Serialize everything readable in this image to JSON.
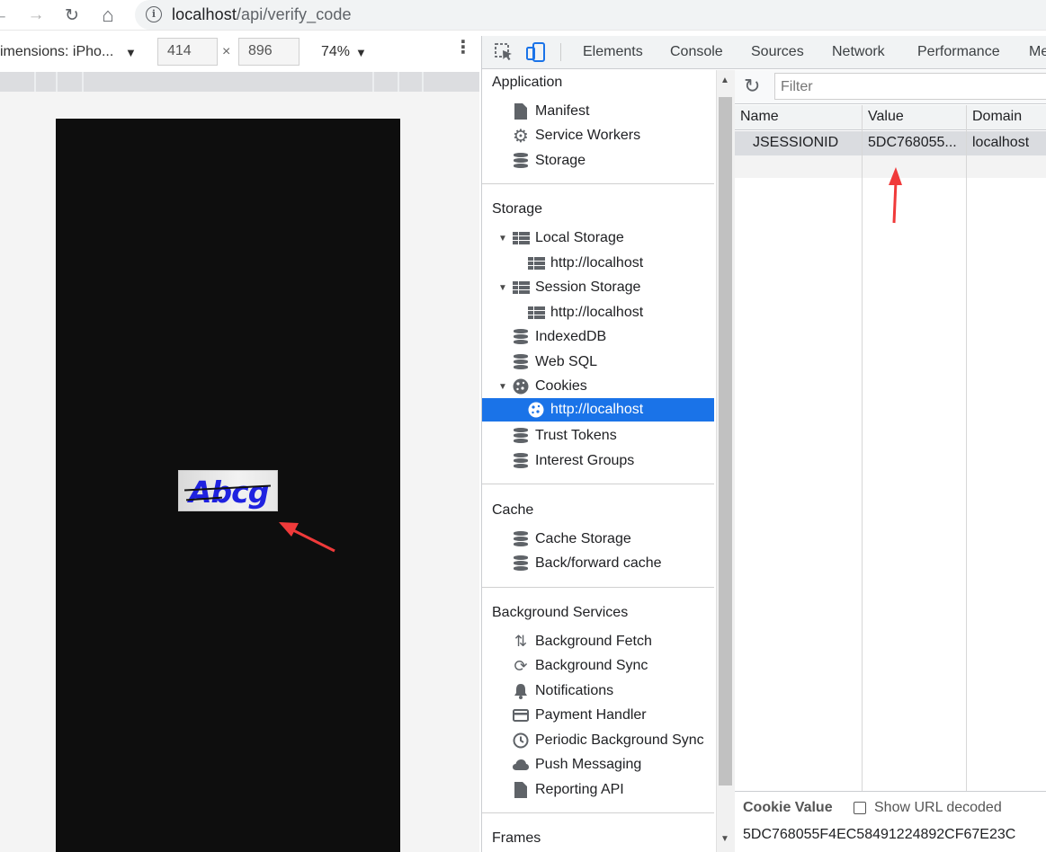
{
  "browser": {
    "url_host": "localhost",
    "url_path": "/api/verify_code",
    "back_glyph": "←",
    "forward_glyph": "→",
    "reload_glyph": "↻",
    "home_glyph": "⌂"
  },
  "device_toolbar": {
    "dimensions_label": "imensions: iPho...",
    "width": "414",
    "height": "896",
    "times": "×",
    "zoom": "74%",
    "caret": "▼",
    "more": "⋮"
  },
  "page": {
    "captcha_text": "Abcg"
  },
  "devtools": {
    "tabs": [
      "Elements",
      "Console",
      "Sources",
      "Network",
      "Performance",
      "Me"
    ],
    "sidebar": {
      "application_header": "Application",
      "application_items": [
        "Manifest",
        "Service Workers",
        "Storage"
      ],
      "storage_header": "Storage",
      "storage_items": {
        "local_storage": "Local Storage",
        "local_storage_origin": "http://localhost",
        "session_storage": "Session Storage",
        "session_storage_origin": "http://localhost",
        "indexeddb": "IndexedDB",
        "web_sql": "Web SQL",
        "cookies": "Cookies",
        "cookies_origin": "http://localhost",
        "trust_tokens": "Trust Tokens",
        "interest_groups": "Interest Groups"
      },
      "cache_header": "Cache",
      "cache_items": [
        "Cache Storage",
        "Back/forward cache"
      ],
      "background_header": "Background Services",
      "background_items": [
        "Background Fetch",
        "Background Sync",
        "Notifications",
        "Payment Handler",
        "Periodic Background Sync",
        "Push Messaging",
        "Reporting API"
      ],
      "frames_header": "Frames"
    },
    "cookies_pane": {
      "filter_placeholder": "Filter",
      "columns": [
        "Name",
        "Value",
        "Domain"
      ],
      "rows": [
        {
          "name": "JSESSIONID",
          "value": "5DC768055...",
          "domain": "localhost"
        }
      ],
      "cookie_value_title": "Cookie Value",
      "show_url_decoded": "Show URL decoded",
      "cookie_value": "5DC768055F4EC58491224892CF67E23C"
    }
  },
  "colors": {
    "selection": "#1a73e8",
    "annotation_arrow": "#f03a3a",
    "captcha_text": "#1f22e0"
  }
}
